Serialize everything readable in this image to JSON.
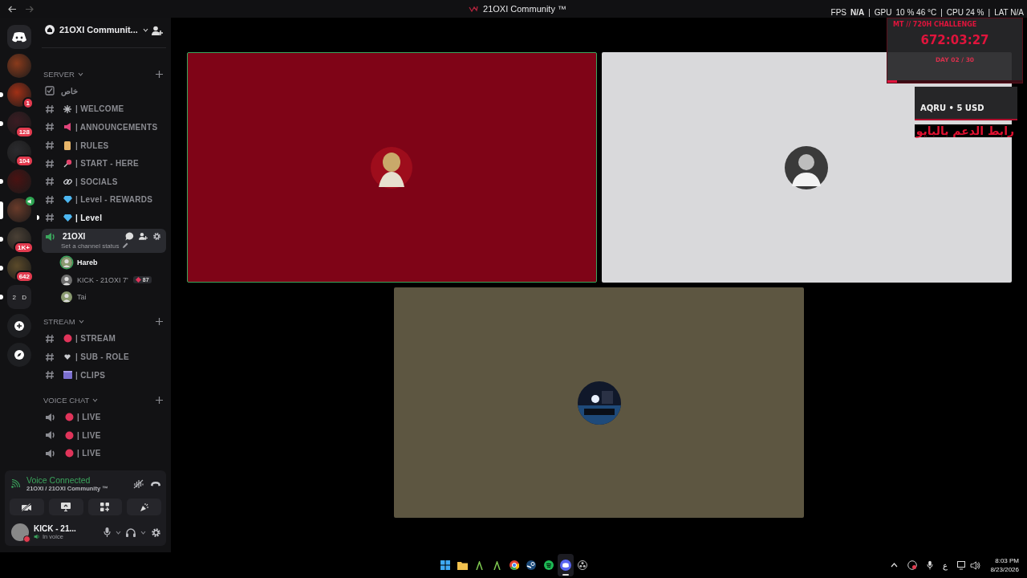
{
  "title_bar": {
    "title": "21OXI Community ™"
  },
  "server_rail": {
    "items": [
      {
        "kind": "home"
      },
      {
        "kind": "server",
        "selected": false,
        "unread": false
      },
      {
        "kind": "server",
        "selected": false,
        "unread": true,
        "badge": "1"
      },
      {
        "kind": "server",
        "selected": false,
        "unread": true,
        "badge": "128"
      },
      {
        "kind": "server",
        "selected": false,
        "unread": false,
        "badge": "104"
      },
      {
        "kind": "server",
        "selected": false,
        "unread": true
      },
      {
        "kind": "server",
        "selected": true,
        "unread": false,
        "in_voice": true
      },
      {
        "kind": "server",
        "selected": false,
        "unread": true,
        "badge": "1K+"
      },
      {
        "kind": "server",
        "selected": false,
        "unread": true,
        "badge": "642"
      },
      {
        "kind": "folder",
        "selected": false,
        "unread": true,
        "texts": [
          "2",
          "D"
        ]
      },
      {
        "kind": "add"
      },
      {
        "kind": "discover"
      }
    ]
  },
  "channel_sidebar": {
    "server_name": "21OXI Communit...",
    "categories": [
      {
        "name": "SERVER",
        "channels": [
          {
            "kind": "checklist",
            "name": "خاص",
            "unread": false
          },
          {
            "kind": "text",
            "name": "| WELCOME",
            "unread": false
          },
          {
            "kind": "text",
            "name": "| ANNOUNCEMENTS",
            "unread": false
          },
          {
            "kind": "text",
            "name": "| RULES",
            "unread": false
          },
          {
            "kind": "text",
            "name": "| START - HERE",
            "unread": false
          },
          {
            "kind": "text",
            "name": "| SOCIALS",
            "unread": false
          },
          {
            "kind": "text",
            "name": "| Level - REWARDS",
            "unread": false
          },
          {
            "kind": "text",
            "name": "| Level",
            "unread": true
          },
          {
            "kind": "voice",
            "name": "21OXI",
            "selected": true,
            "status": "Set a channel status",
            "members": [
              {
                "name": "Hareb",
                "speaking": true
              },
              {
                "name": "KICK - 21OXI 7'",
                "speaking": false,
                "badge": "87"
              },
              {
                "name": "Tai",
                "speaking": false
              }
            ]
          }
        ]
      },
      {
        "name": "STREAM",
        "channels": [
          {
            "kind": "text",
            "name": "| STREAM",
            "unread": false
          },
          {
            "kind": "text",
            "name": "| SUB - ROLE",
            "unread": false
          },
          {
            "kind": "text",
            "name": "| CLIPS",
            "unread": false
          }
        ]
      },
      {
        "name": "VOICE CHAT",
        "channels": [
          {
            "kind": "voice",
            "name": "| LIVE",
            "selected": false
          },
          {
            "kind": "voice",
            "name": "| LIVE",
            "selected": false
          },
          {
            "kind": "voice",
            "name": "| LIVE",
            "selected": false
          }
        ]
      }
    ]
  },
  "voice_panel": {
    "status": "Voice Connected",
    "location": "21OXI / 21OXI Community ™",
    "user_name": "KICK - 21...",
    "user_status": "In voice"
  },
  "video_tiles": [
    {
      "speaking": true
    },
    {
      "speaking": false
    },
    {
      "speaking": false
    }
  ],
  "stream_overlay": {
    "stats": [
      "FPS",
      "N/A",
      "|",
      "GPU",
      "10 % 46 °C",
      "|",
      "CPU 24 %",
      "|",
      "LAT N/A"
    ],
    "challenge": {
      "title": "MT // 720H CHALLENGE",
      "timer": "672:03:27",
      "day": "DAY 02 / 30",
      "level": 0.07
    },
    "donation": "AQRU • 5 USD",
    "support_text": "رابط الدعم بالبايو"
  },
  "taskbar": {
    "apps": [
      {
        "kind": "windows",
        "active": false
      },
      {
        "kind": "folder",
        "active": false
      },
      {
        "kind": "lambda",
        "active": false
      },
      {
        "kind": "lambda",
        "active": false
      },
      {
        "kind": "browser",
        "active": false
      },
      {
        "kind": "steam",
        "active": false
      },
      {
        "kind": "music",
        "active": false
      },
      {
        "kind": "chat",
        "active": true
      },
      {
        "kind": "recorder",
        "active": false
      }
    ],
    "keyboard": "ع",
    "time": "8:03 PM",
    "date": "8/23/2026"
  }
}
